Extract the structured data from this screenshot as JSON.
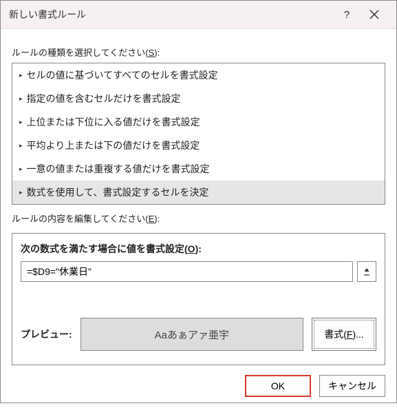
{
  "titlebar": {
    "title": "新しい書式ルール",
    "help": "?",
    "close": "×"
  },
  "ruleTypeLabel": {
    "prefix": "ルールの種類を選択してください(",
    "hotkey": "S",
    "suffix": "):"
  },
  "ruleTypes": [
    "セルの値に基づいてすべてのセルを書式設定",
    "指定の値を含むセルだけを書式設定",
    "上位または下位に入る値だけを書式設定",
    "平均より上または下の値だけを書式設定",
    "一意の値または重複する値だけを書式設定",
    "数式を使用して、書式設定するセルを決定"
  ],
  "selectedRuleIndex": 5,
  "editLabel": {
    "prefix": "ルールの内容を編集してください(",
    "hotkey": "E",
    "suffix": "):"
  },
  "formulaHeading": {
    "prefix": "次の数式を満たす場合に値を書式設定(",
    "hotkey": "O",
    "suffix": "):"
  },
  "formulaValue": "=$D9=\"休業日\"",
  "preview": {
    "label": "プレビュー:",
    "sample": "Aaあぁアァ亜宇"
  },
  "formatBtn": {
    "prefix": "書式(",
    "hotkey": "F",
    "suffix": ")..."
  },
  "buttons": {
    "ok": "OK",
    "cancel": "キャンセル"
  }
}
